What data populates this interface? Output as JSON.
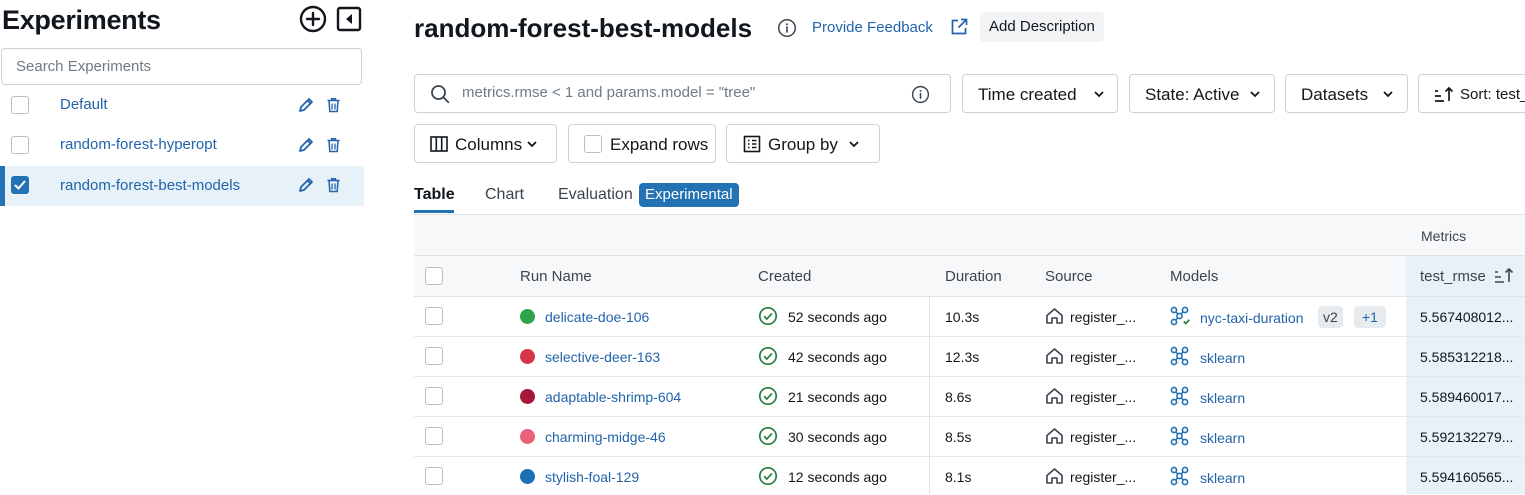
{
  "sidebar": {
    "title": "Experiments",
    "search_placeholder": "Search Experiments",
    "experiments": [
      {
        "name": "Default",
        "selected": false
      },
      {
        "name": "random-forest-hyperopt",
        "selected": false
      },
      {
        "name": "random-forest-best-models",
        "selected": true
      }
    ]
  },
  "header": {
    "title": "random-forest-best-models",
    "feedback_label": "Provide Feedback",
    "add_description_label": "Add Description"
  },
  "filters": {
    "search_placeholder": "metrics.rmse < 1 and params.model = \"tree\"",
    "time_created_label": "Time created",
    "state_label": "State: Active",
    "datasets_label": "Datasets",
    "sort_label": "Sort: test_",
    "columns_label": "Columns",
    "expand_rows_label": "Expand rows",
    "group_by_label": "Group by"
  },
  "tabs": {
    "table": "Table",
    "chart": "Chart",
    "evaluation": "Evaluation",
    "experimental_badge": "Experimental",
    "active": "table"
  },
  "table": {
    "group_header": "Metrics",
    "columns": {
      "run_name": "Run Name",
      "created": "Created",
      "duration": "Duration",
      "source": "Source",
      "models": "Models",
      "metric": "test_rmse"
    },
    "rows": [
      {
        "run_name": "delicate-doe-106",
        "dot_color": "#2fa34a",
        "created": "52 seconds ago",
        "duration": "10.3s",
        "source": "register_...",
        "model": "nyc-taxi-duration",
        "model_version": "v2",
        "model_extra": "+1",
        "registered": true,
        "metric": "5.567408012..."
      },
      {
        "run_name": "selective-deer-163",
        "dot_color": "#d53546",
        "created": "42 seconds ago",
        "duration": "12.3s",
        "source": "register_...",
        "model": "sklearn",
        "registered": false,
        "metric": "5.585312218..."
      },
      {
        "run_name": "adaptable-shrimp-604",
        "dot_color": "#a61838",
        "created": "21 seconds ago",
        "duration": "8.6s",
        "source": "register_...",
        "model": "sklearn",
        "registered": false,
        "metric": "5.589460017..."
      },
      {
        "run_name": "charming-midge-46",
        "dot_color": "#e8607a",
        "created": "30 seconds ago",
        "duration": "8.5s",
        "source": "register_...",
        "model": "sklearn",
        "registered": false,
        "metric": "5.592132279..."
      },
      {
        "run_name": "stylish-foal-129",
        "dot_color": "#1c6fb5",
        "created": "12 seconds ago",
        "duration": "8.1s",
        "source": "register_...",
        "model": "sklearn",
        "registered": false,
        "metric": "5.594160565..."
      }
    ]
  },
  "colors": {
    "accent": "#2272b4",
    "link": "#2264ab",
    "success": "#277c43"
  }
}
